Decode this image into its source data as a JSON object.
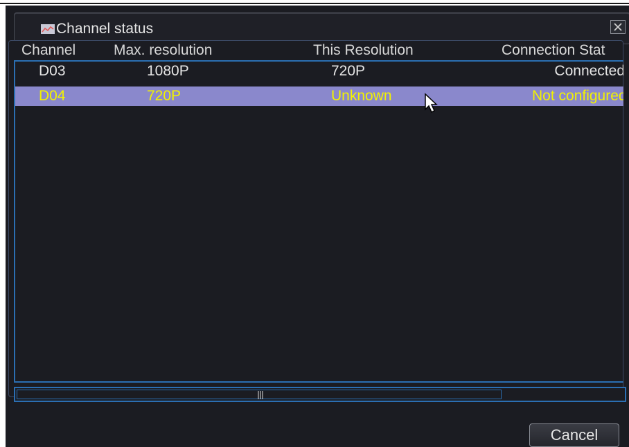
{
  "window": {
    "title": "Channel status",
    "close_symbol": "×",
    "title_icon": "chart-icon",
    "close_icon": "close-icon"
  },
  "table": {
    "columns": [
      "Channel",
      "Max. resolution",
      "This Resolution",
      "Connection Stat"
    ],
    "rows": [
      {
        "channel": "D03",
        "max_resolution": "1080P",
        "this_resolution": "720P",
        "connection_status": "Connected",
        "selected": false
      },
      {
        "channel": "D04",
        "max_resolution": "720P",
        "this_resolution": "Unknown",
        "connection_status": "Not configured",
        "selected": true
      }
    ]
  },
  "scrollbar": {
    "grip_icon": "grip-icon"
  },
  "footer": {
    "cancel_label": "Cancel"
  },
  "colors": {
    "background": "#1b1c22",
    "accent_border": "#2b6fb3",
    "selected_row": "#8a88cc",
    "selected_text": "#f2f200",
    "text": "#e6e6e6"
  }
}
